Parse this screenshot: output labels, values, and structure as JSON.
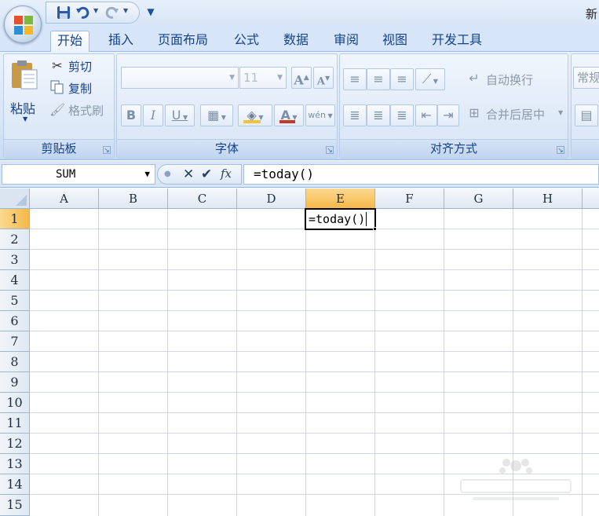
{
  "window": {
    "title": "新"
  },
  "quick_access": {
    "icons": [
      "save-icon",
      "undo-icon",
      "redo-icon",
      "customize-icon"
    ]
  },
  "tabs": [
    {
      "label": "开始",
      "active": true
    },
    {
      "label": "插入"
    },
    {
      "label": "页面布局"
    },
    {
      "label": "公式"
    },
    {
      "label": "数据"
    },
    {
      "label": "审阅"
    },
    {
      "label": "视图"
    },
    {
      "label": "开发工具"
    }
  ],
  "clipboard": {
    "group_label": "剪贴板",
    "paste": "粘贴",
    "cut": "剪切",
    "copy": "复制",
    "format_painter": "格式刷"
  },
  "font": {
    "group_label": "字体",
    "font_name": "",
    "font_size": "11",
    "bold": "B",
    "italic": "I",
    "underline": "U",
    "font_color_letter": "A",
    "grow": "A",
    "shrink": "A",
    "phonetic": "wén"
  },
  "alignment": {
    "group_label": "对齐方式",
    "wrap_text": "自动换行",
    "merge_center": "合并后居中"
  },
  "number": {
    "format": "常规"
  },
  "formula_bar": {
    "name_box": "SUM",
    "formula": "=today()"
  },
  "grid": {
    "columns": [
      "A",
      "B",
      "C",
      "D",
      "E",
      "F",
      "G",
      "H"
    ],
    "rows": [
      "1",
      "2",
      "3",
      "4",
      "5",
      "6",
      "7",
      "8",
      "9",
      "10",
      "11",
      "12",
      "13",
      "14",
      "15"
    ],
    "active_cell_text": "=today()"
  },
  "colors": {
    "accent": "#15428b",
    "selected_header": "#f6b84a"
  }
}
